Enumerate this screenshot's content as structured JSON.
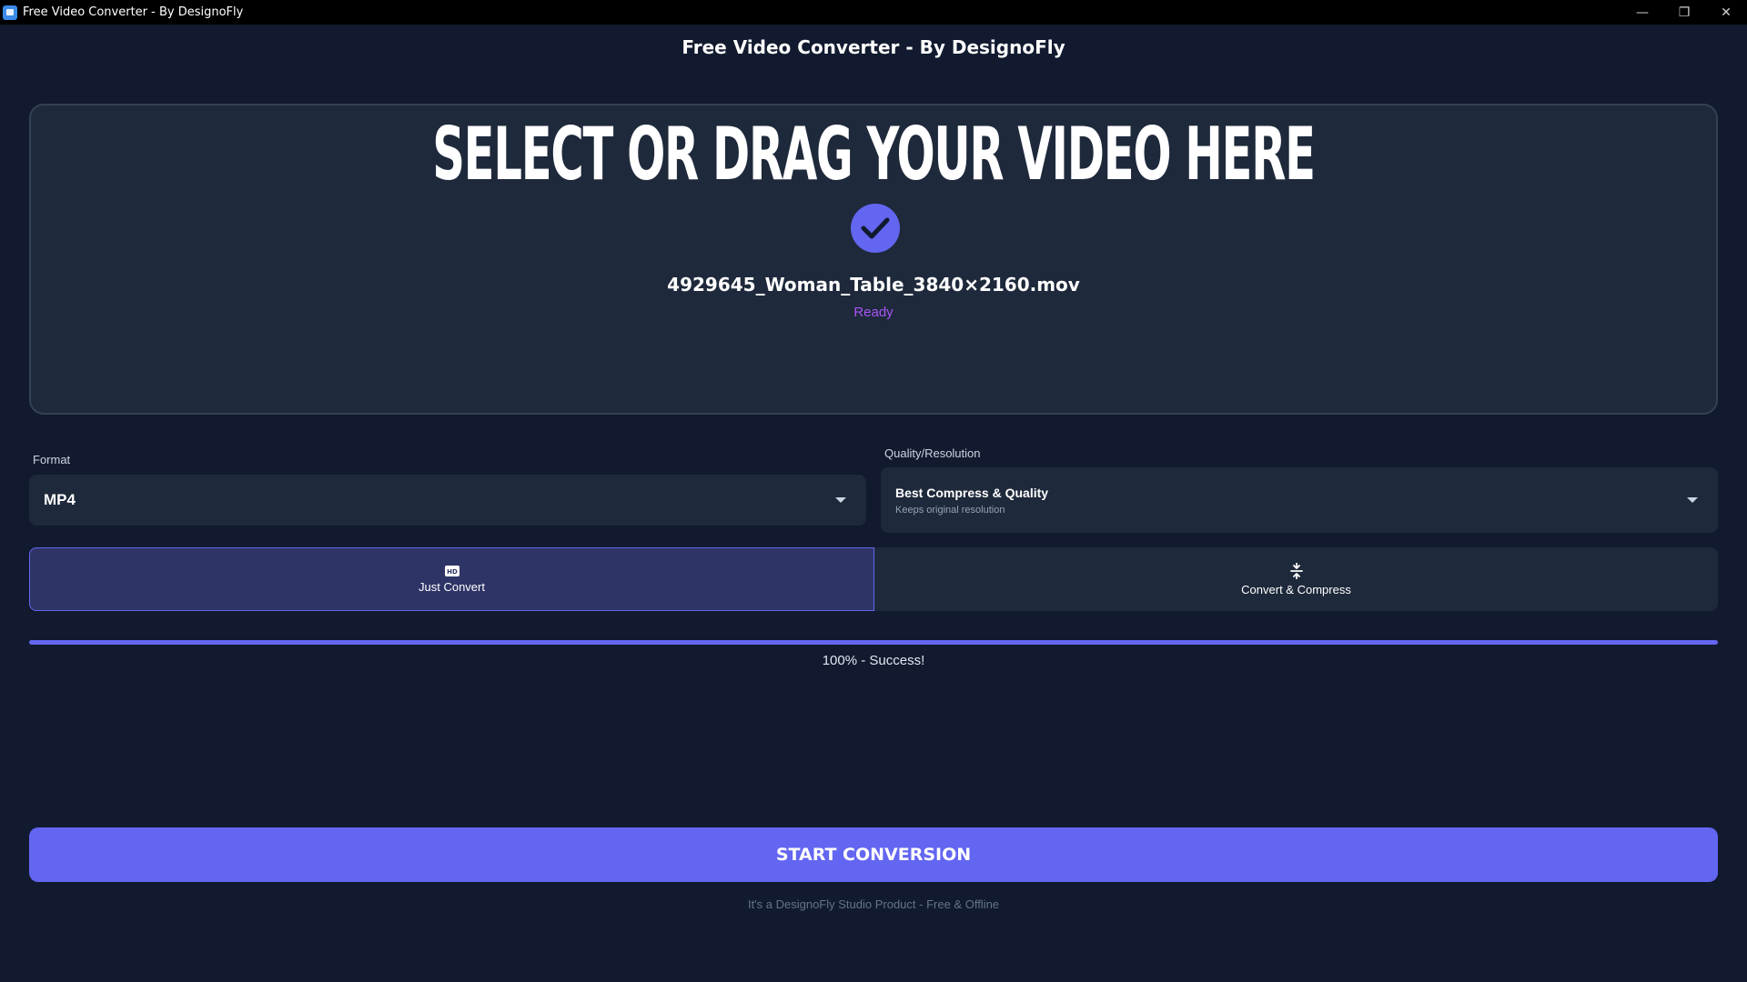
{
  "window": {
    "title": "Free Video Converter - By DesignoFly",
    "minimize_glyph": "—",
    "restore_glyph": "❐",
    "close_glyph": "✕"
  },
  "header": {
    "title": "Free Video Converter - By DesignoFly"
  },
  "dropzone": {
    "title": "SELECT OR DRAG YOUR VIDEO HERE",
    "file_name": "4929645_Woman_Table_3840×2160.mov",
    "status": "Ready",
    "status_icon": "check-circle-icon"
  },
  "format": {
    "label": "Format",
    "selected": "MP4"
  },
  "quality": {
    "label": "Quality/Resolution",
    "selected_title": "Best Compress & Quality",
    "selected_subtitle": "Keeps original resolution"
  },
  "modes": [
    {
      "label": "Just Convert",
      "icon": "hd-icon",
      "active": true
    },
    {
      "label": "Convert & Compress",
      "icon": "compress-icon",
      "active": false
    }
  ],
  "progress": {
    "percent": 100,
    "text": "100% - Success!"
  },
  "start_button": {
    "label": "START CONVERSION"
  },
  "footer": {
    "text": "It's a DesignoFly Studio Product - Free & Offline"
  },
  "colors": {
    "accent": "#6366f1",
    "background": "#111a2e",
    "panel": "#1e293b",
    "status": "#a855f7"
  }
}
